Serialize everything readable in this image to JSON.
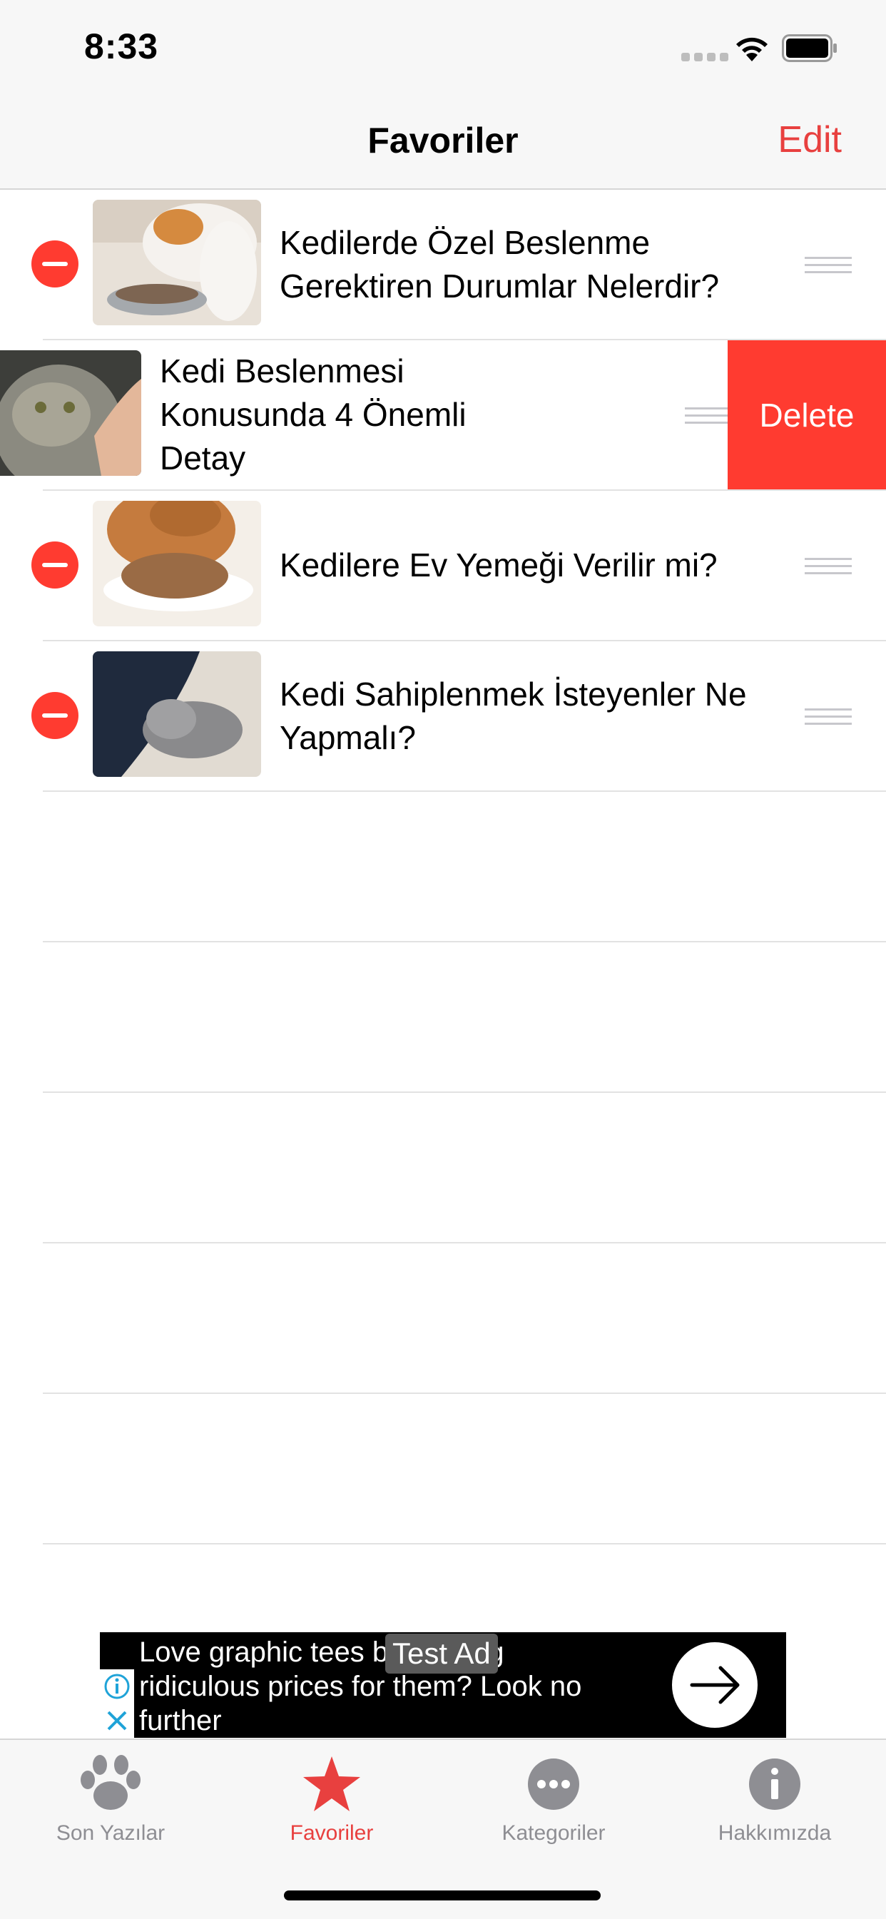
{
  "status_bar": {
    "time": "8:33"
  },
  "nav": {
    "title": "Favoriler",
    "edit_label": "Edit"
  },
  "list": {
    "items": [
      {
        "title": "Kedilerde Özel Beslenme Gerektiren Durumlar Nelerdir?"
      },
      {
        "title": "Kedi Beslenmesi Konusunda 4 Önemli Detay",
        "delete_label": "Delete"
      },
      {
        "title": "Kedilere Ev Yemeği Verilir mi?"
      },
      {
        "title": "Kedi Sahiplenmek İsteyenler Ne Yapmalı?"
      }
    ]
  },
  "ad": {
    "text": "Love graphic tees but paying ridiculous prices for them? Look no further",
    "tag": "Test Ad"
  },
  "tab_bar": {
    "tabs": [
      {
        "label": "Son Yazılar",
        "icon": "paw-icon"
      },
      {
        "label": "Favoriler",
        "icon": "star-icon",
        "active": true
      },
      {
        "label": "Kategoriler",
        "icon": "more-icon"
      },
      {
        "label": "Hakkımızda",
        "icon": "info-icon"
      }
    ]
  },
  "colors": {
    "accent": "#e8403f",
    "delete": "#ff3b30",
    "inactive": "#8e8e93"
  }
}
